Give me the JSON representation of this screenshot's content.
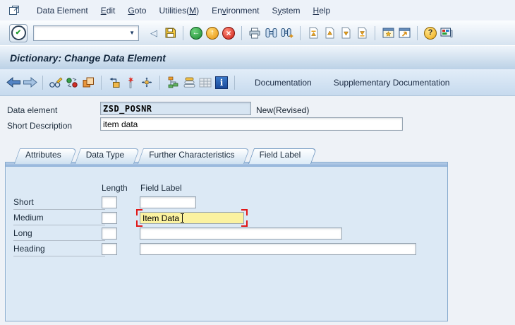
{
  "menubar": {
    "items": [
      {
        "label": "Data Element",
        "underline": null
      },
      {
        "label": "Edit",
        "underline": 0
      },
      {
        "label": "Goto",
        "underline": 0
      },
      {
        "label": "Utilities(M)",
        "underline": 10
      },
      {
        "label": "Environment",
        "underline": 2
      },
      {
        "label": "System",
        "underline": 1
      },
      {
        "label": "Help",
        "underline": 0
      }
    ]
  },
  "toolbar": {
    "command_field": {
      "value": "",
      "placeholder": ""
    },
    "icons": [
      {
        "type": "icon",
        "name": "hide-command-field",
        "glyph": "back-triangle"
      },
      {
        "type": "icon",
        "name": "save",
        "glyph": "save"
      },
      {
        "type": "sep"
      },
      {
        "type": "icon",
        "name": "back",
        "glyph": "back-circle"
      },
      {
        "type": "icon",
        "name": "exit",
        "glyph": "exit-circle"
      },
      {
        "type": "icon",
        "name": "cancel",
        "glyph": "cancel-circle"
      },
      {
        "type": "sep"
      },
      {
        "type": "icon",
        "name": "print",
        "glyph": "printer"
      },
      {
        "type": "icon",
        "name": "find",
        "glyph": "binoculars"
      },
      {
        "type": "icon",
        "name": "find-next",
        "glyph": "binoculars-plus"
      },
      {
        "type": "sep"
      },
      {
        "type": "icon",
        "name": "first-page",
        "glyph": "page-first"
      },
      {
        "type": "icon",
        "name": "previous-page",
        "glyph": "page-up"
      },
      {
        "type": "icon",
        "name": "next-page",
        "glyph": "page-down"
      },
      {
        "type": "icon",
        "name": "last-page",
        "glyph": "page-last"
      },
      {
        "type": "sep"
      },
      {
        "type": "icon",
        "name": "new-session",
        "glyph": "window-star"
      },
      {
        "type": "icon",
        "name": "create-shortcut",
        "glyph": "window-arrow"
      },
      {
        "type": "sep"
      },
      {
        "type": "icon",
        "name": "help",
        "glyph": "help-circle"
      },
      {
        "type": "icon",
        "name": "customize-local-layout",
        "glyph": "monitor"
      }
    ]
  },
  "titlebar": {
    "title": "Dictionary: Change Data Element"
  },
  "apptoolbar": {
    "icons": [
      {
        "type": "icon",
        "name": "previous-screen",
        "glyph": "arrow-left-blue"
      },
      {
        "type": "icon",
        "name": "next-screen",
        "glyph": "arrow-right-blue"
      },
      {
        "type": "sep"
      },
      {
        "type": "icon",
        "name": "display-change",
        "glyph": "pencil-glasses"
      },
      {
        "type": "icon",
        "name": "refresh",
        "glyph": "two-circles"
      },
      {
        "type": "icon",
        "name": "copy-object",
        "glyph": "orange-squares"
      },
      {
        "type": "sep"
      },
      {
        "type": "icon",
        "name": "where-used-list",
        "glyph": "box-arrow"
      },
      {
        "type": "icon",
        "name": "activate",
        "glyph": "wand"
      },
      {
        "type": "icon",
        "name": "distribution",
        "glyph": "cross-arrows"
      },
      {
        "type": "sep"
      },
      {
        "type": "icon",
        "name": "hierarchy-display",
        "glyph": "org-chart"
      },
      {
        "type": "icon",
        "name": "object-list",
        "glyph": "stack"
      },
      {
        "type": "icon",
        "name": "grid-display",
        "glyph": "grid-gray"
      },
      {
        "type": "icon",
        "name": "information",
        "glyph": "info-square"
      },
      {
        "type": "sep"
      },
      {
        "type": "text",
        "name": "documentation-button",
        "label": "Documentation"
      },
      {
        "type": "text",
        "name": "supplementary-documentation-button",
        "label": "Supplementary Documentation"
      }
    ]
  },
  "header_fields": {
    "data_element_label": "Data element",
    "data_element_value": "ZSD_POSNR",
    "status": "New(Revised)",
    "short_description_label": "Short Description",
    "short_description_value": "item data"
  },
  "tabs": [
    {
      "label": "Attributes",
      "active": false
    },
    {
      "label": "Data Type",
      "active": false
    },
    {
      "label": "Further Characteristics",
      "active": false
    },
    {
      "label": "Field Label",
      "active": true
    }
  ],
  "field_label_form": {
    "column_headers": {
      "length": "Length",
      "field_label": "Field Label"
    },
    "rows": [
      {
        "label": "Short",
        "length_value": "",
        "field_value": "",
        "focused": false
      },
      {
        "label": "Medium",
        "length_value": "",
        "field_value": "Item Data",
        "focused": true
      },
      {
        "label": "Long",
        "length_value": "",
        "field_value": "",
        "focused": false
      },
      {
        "label": "Heading",
        "length_value": "",
        "field_value": "",
        "focused": false
      }
    ]
  },
  "colors": {
    "panel_bg": "#dce9f5",
    "focus_yellow": "#fbf2a0",
    "focus_corner_red": "#e01818",
    "key_field_bg": "#d7e5f2",
    "toolbar_bg": "#d6e3f0"
  }
}
